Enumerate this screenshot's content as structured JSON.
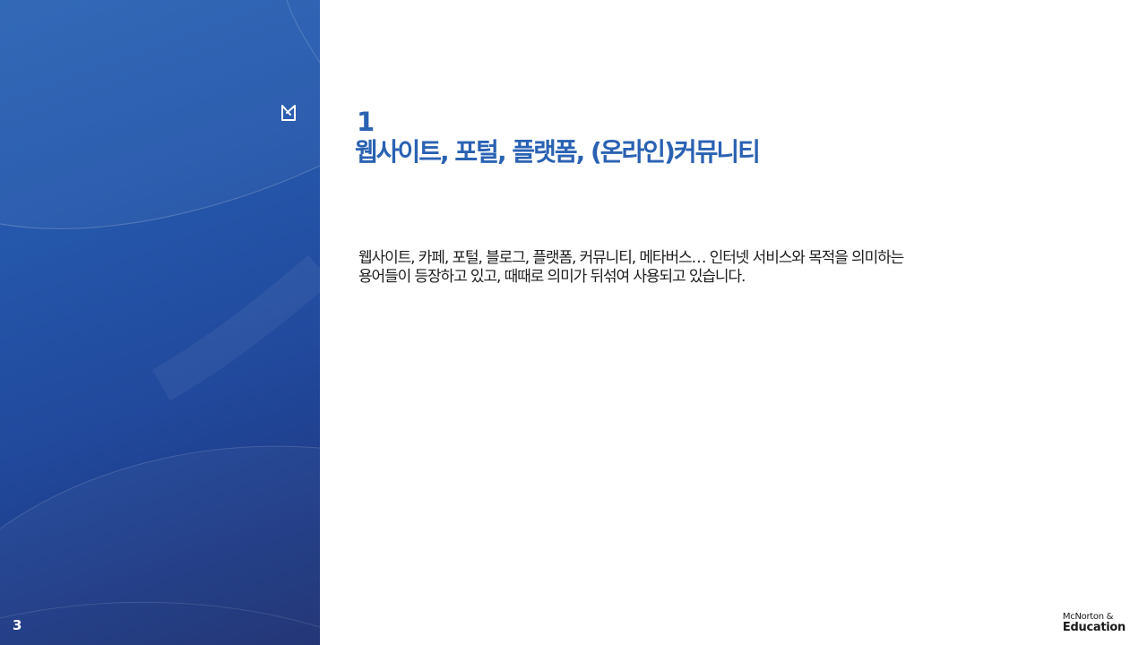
{
  "slide": {
    "page_number": "3",
    "section_number": "1",
    "title": "웹사이트, 포털, 플랫폼, (온라인)커뮤니티",
    "body_lines": [
      "웹사이트, 카페, 포털, 블로그, 플랫폼, 커뮤니티, 메타버스… 인터넷 서비스와 목적을 의미하는",
      "용어들이 등장하고 있고, 때때로  의미가 뒤섞여 사용되고 있습니다."
    ]
  },
  "branding": {
    "side_mark_icon": "publisher-monogram-icon",
    "publisher_line1": "McNorton &",
    "publisher_line2": "Education"
  },
  "colors": {
    "accent": "#2a62b3",
    "panel_top": "#2a63b4",
    "panel_bottom": "#1c2f72",
    "body_text": "#1d1d1d"
  }
}
